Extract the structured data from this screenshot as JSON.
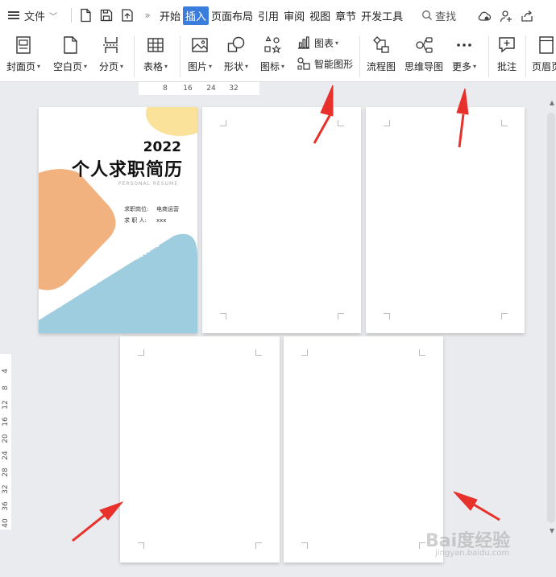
{
  "menubar": {
    "file_label": "文件",
    "tabs": [
      "开始",
      "插入",
      "页面布局",
      "引用",
      "审阅",
      "视图",
      "章节",
      "开发工具"
    ],
    "active_tab": "插入",
    "search_label": "查找"
  },
  "ribbon": {
    "cover_page": "封面页",
    "blank_page": "空白页",
    "page_break": "分页",
    "table": "表格",
    "picture": "图片",
    "shape": "形状",
    "icon": "图标",
    "chart": "图表",
    "smart_art": "智能图形",
    "flowchart": "流程图",
    "mind_map": "思维导图",
    "more": "更多",
    "comment": "批注",
    "header_footer": "页眉页"
  },
  "hruler_ticks": [
    "8",
    "16",
    "24",
    "32"
  ],
  "vruler_ticks": [
    "4",
    "8",
    "12",
    "16",
    "20",
    "24",
    "28",
    "32",
    "36",
    "40"
  ],
  "cover": {
    "year": "2022",
    "title": "个人求职简历",
    "subtitle_en": "PERSONAL RESUME",
    "position_label": "求职岗位:",
    "position_value": "电商运营",
    "name_label": "求 职 人:",
    "name_value": "xxx",
    "deco_text_1": "PERSONAL",
    "deco_text_2": "RESUME"
  },
  "colors": {
    "accent_tab": "#3b7ddd",
    "cover_orange": "#f2b27f",
    "cover_yellow": "#fbe29b",
    "cover_blue": "#9fcde0",
    "arrow_red": "#e8312b"
  },
  "watermark": {
    "brand": "Bai度经验",
    "url": "jingyan.baidu.com"
  }
}
